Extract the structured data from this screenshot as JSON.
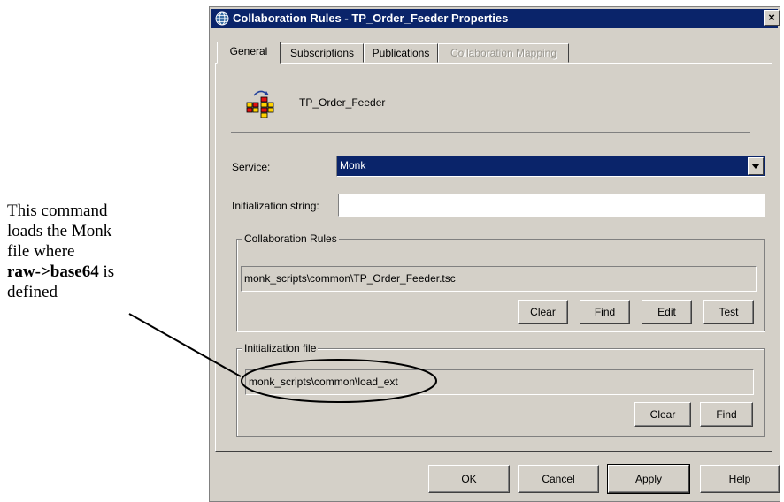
{
  "annotation": {
    "line1": "This command",
    "line2": "loads the Monk",
    "line3": "file where",
    "line4_bold": "raw->base64",
    "line4_rest": " is",
    "line5": "defined"
  },
  "window": {
    "title": "Collaboration Rules - TP_Order_Feeder Properties",
    "close_label": "×",
    "icon": "globe-icon"
  },
  "tabs": [
    {
      "label": "General",
      "active": true,
      "enabled": true
    },
    {
      "label": "Subscriptions",
      "active": false,
      "enabled": true
    },
    {
      "label": "Publications",
      "active": false,
      "enabled": true
    },
    {
      "label": "Collaboration Mapping",
      "active": false,
      "enabled": false
    }
  ],
  "general": {
    "collaboration_name": "TP_Order_Feeder",
    "service_label": "Service:",
    "service_value": "Monk",
    "init_string_label": "Initialization string:",
    "init_string_value": "",
    "collab_rules": {
      "legend": "Collaboration Rules",
      "path": "monk_scripts\\common\\TP_Order_Feeder.tsc",
      "buttons": [
        "Clear",
        "Find",
        "Edit",
        "Test"
      ]
    },
    "init_file": {
      "legend": "Initialization file",
      "path": "monk_scripts\\common\\load_ext",
      "buttons": [
        "Clear",
        "Find"
      ]
    }
  },
  "footer_buttons": {
    "ok": "OK",
    "cancel": "Cancel",
    "apply": "Apply",
    "help": "Help"
  }
}
